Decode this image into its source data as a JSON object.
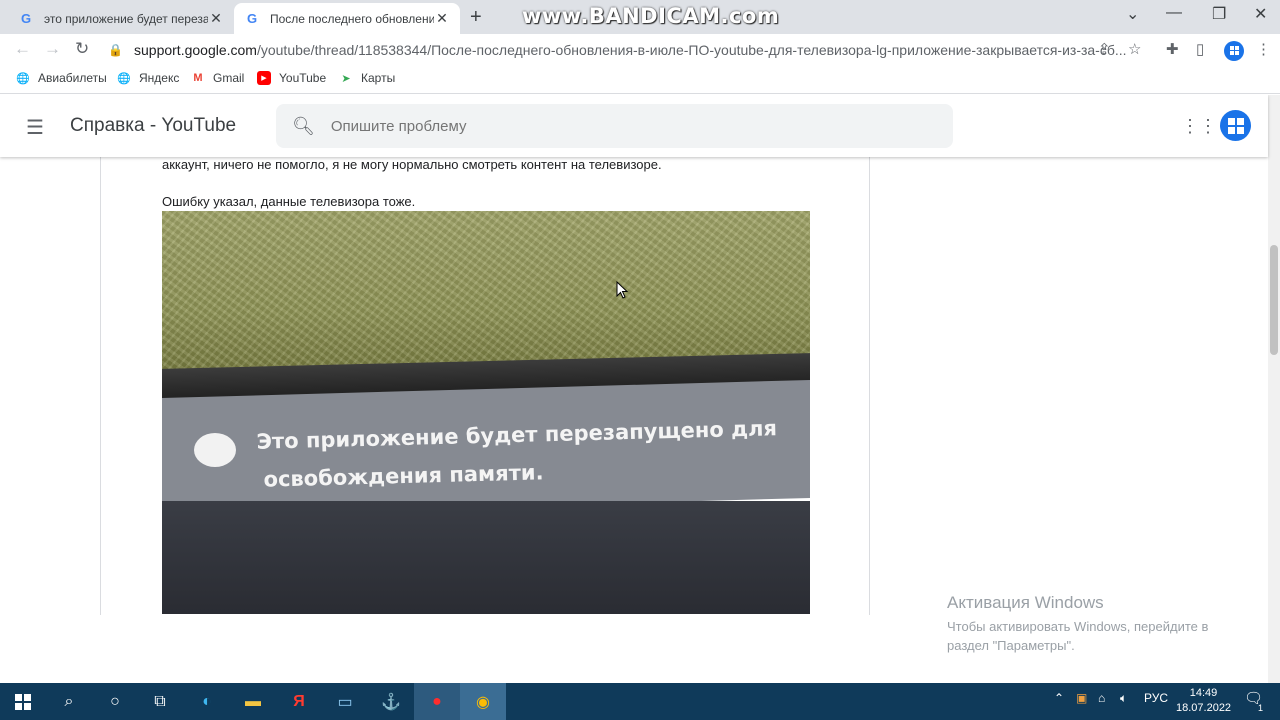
{
  "browser": {
    "tabs": [
      {
        "label": "это приложение будет перезапущено",
        "close": "✕"
      },
      {
        "label": "После последнего обновления в июле",
        "close": "✕"
      }
    ],
    "new_tab": "+",
    "watermark": "www.BANDICAM.com",
    "controls": {
      "dropdown": "⌄",
      "minimize": "—",
      "restore": "❐",
      "close": "✕"
    },
    "url_host": "support.google.com",
    "url_path": "/youtube/thread/118538344/После-последнего-обновления-в-июле-ПО-youtube-для-телевизора-lg-приложение-закрывается-из-за-сб...",
    "bookmarks": [
      {
        "label": "Авиабилеты",
        "icon": "globe-icon"
      },
      {
        "label": "Яндекс",
        "icon": "globe-icon"
      },
      {
        "label": "Gmail",
        "icon": "gmail-icon"
      },
      {
        "label": "YouTube",
        "icon": "youtube-icon"
      },
      {
        "label": "Карты",
        "icon": "maps-icon"
      }
    ]
  },
  "header": {
    "title": "Справка - YouTube",
    "search_placeholder": "Опишите проблему"
  },
  "post": {
    "line1": "аккаунт, ничего не помогло, я не могу нормально смотреть контент на телевизоре.",
    "line2": "Ошибку указал, данные телевизора тоже.",
    "photo_message_1": "Это приложение будет перезапущено для",
    "photo_message_2": "освобождения памяти."
  },
  "activation": {
    "title": "Активация Windows",
    "text": "Чтобы активировать Windows, перейдите в раздел \"Параметры\"."
  },
  "taskbar": {
    "lang": "РУС",
    "time": "14:49",
    "date": "18.07.2022",
    "notify_count": "1"
  }
}
